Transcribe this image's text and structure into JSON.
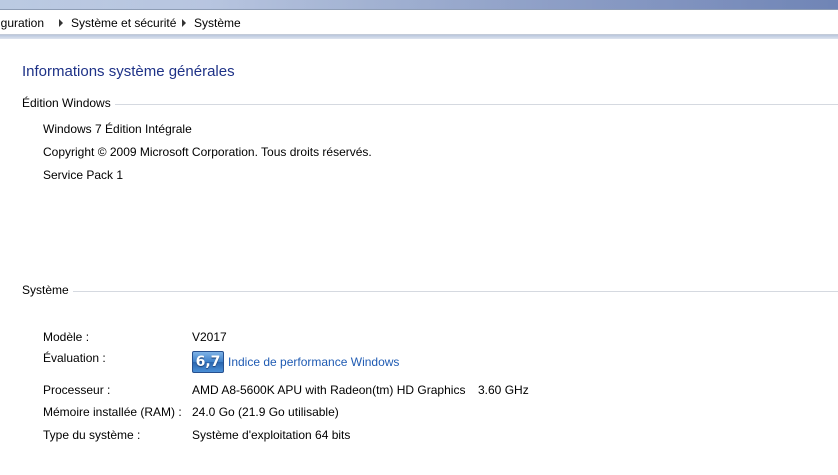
{
  "breadcrumb": {
    "items": [
      "iguration",
      "Système et sécurité",
      "Système"
    ]
  },
  "page_title": "Informations système générales",
  "windows_edition": {
    "heading": "Édition Windows",
    "lines": [
      "Windows 7 Édition Intégrale",
      "Copyright © 2009 Microsoft Corporation. Tous droits réservés.",
      "Service Pack 1"
    ]
  },
  "system": {
    "heading": "Système",
    "model": {
      "label": "Modèle :",
      "value": "V2017"
    },
    "rating": {
      "label": "Évaluation :",
      "score": "6,7",
      "link": "Indice de performance Windows"
    },
    "processor": {
      "label": "Processeur :",
      "value": "AMD A8-5600K APU with Radeon(tm) HD Graphics",
      "speed": "3.60 GHz"
    },
    "memory": {
      "label": "Mémoire installée (RAM) :",
      "value": "24.0 Go (21.9 Go utilisable)"
    },
    "system_type": {
      "label": "Type du système :",
      "value": "Système d'exploitation 64 bits"
    }
  },
  "colors": {
    "title": "#1e3287",
    "link": "#1f5bb3",
    "section_line": "#d5d9e0",
    "score_badge": "#3d7fc8"
  }
}
